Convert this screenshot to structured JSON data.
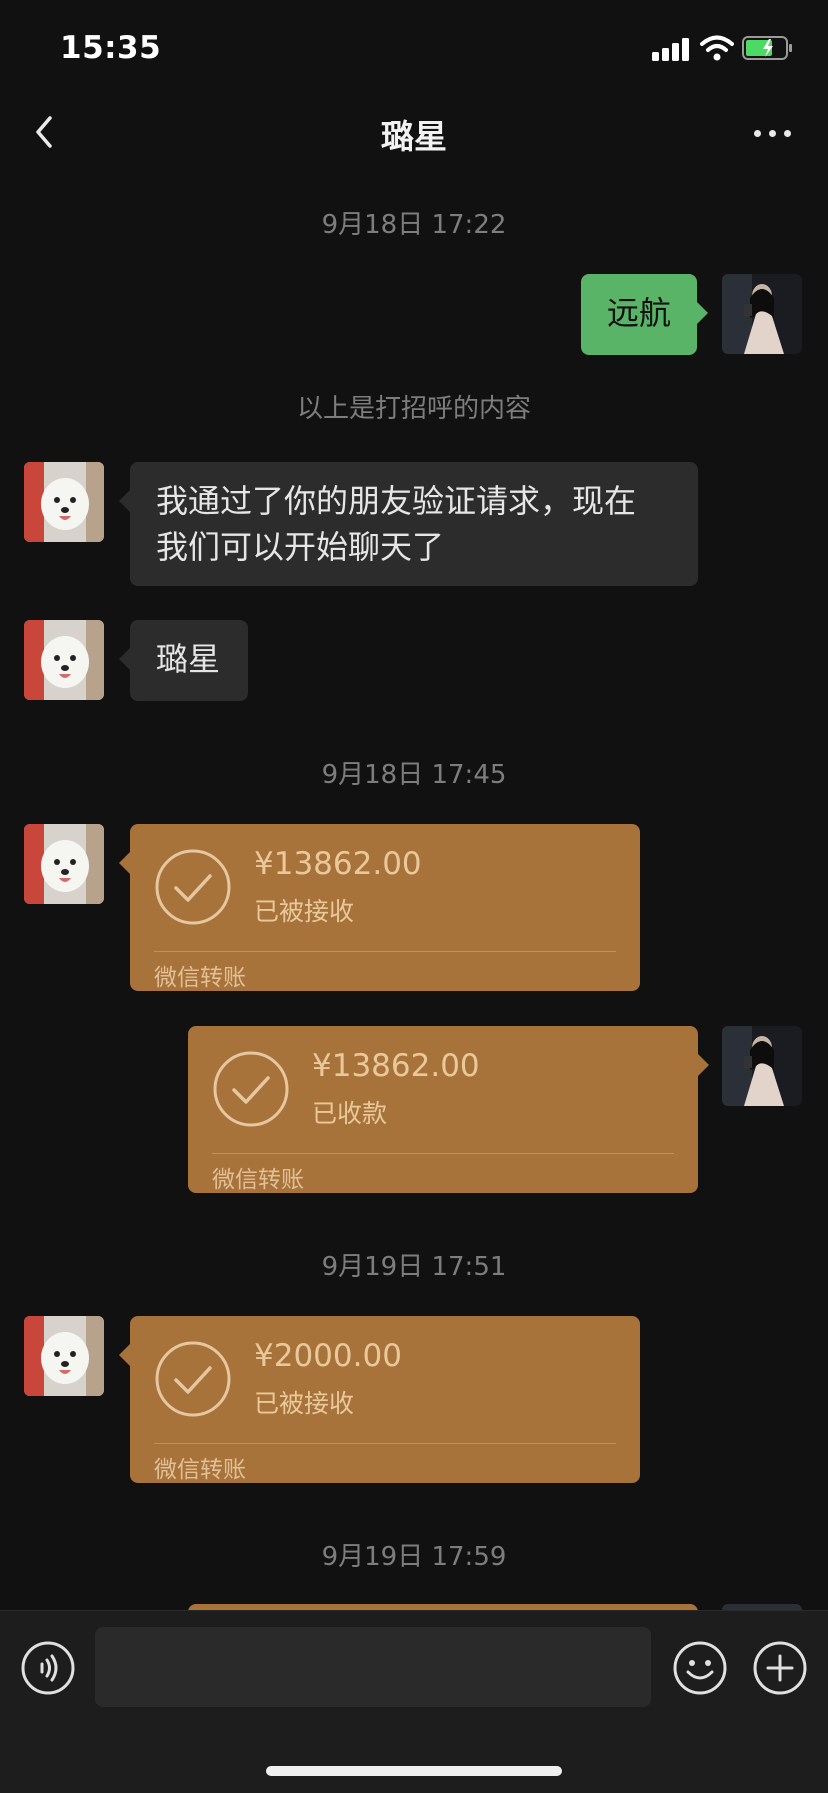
{
  "status_bar": {
    "time": "15:35"
  },
  "header": {
    "title": "璐星"
  },
  "messages": {
    "time_1": "9月18日 17:22",
    "outgoing_text": "远航",
    "system_note": "以上是打招呼的内容",
    "incoming_text_1_line1": "我通过了你的朋友验证请求，现在",
    "incoming_text_1_line2": "我们可以开始聊天了",
    "incoming_text_2": "璐星",
    "time_2": "9月18日 17:45",
    "transfer_1": {
      "amount": "¥13862.00",
      "status": "已被接收",
      "label": "微信转账"
    },
    "transfer_2": {
      "amount": "¥13862.00",
      "status": "已收款",
      "label": "微信转账"
    },
    "time_3": "9月19日 17:51",
    "transfer_3": {
      "amount": "¥2000.00",
      "status": "已被接收",
      "label": "微信转账"
    },
    "time_4": "9月19日 17:59"
  },
  "input": {
    "value": ""
  },
  "colors": {
    "background": "#111111",
    "bubble_incoming": "#2c2c2c",
    "bubble_outgoing": "#5ab467",
    "transfer_card": "#a7733a"
  },
  "icons": [
    "back-icon",
    "more-icon",
    "voice-icon",
    "emoji-icon",
    "plus-icon",
    "check-icon",
    "signal-icon",
    "wifi-icon",
    "battery-icon"
  ]
}
